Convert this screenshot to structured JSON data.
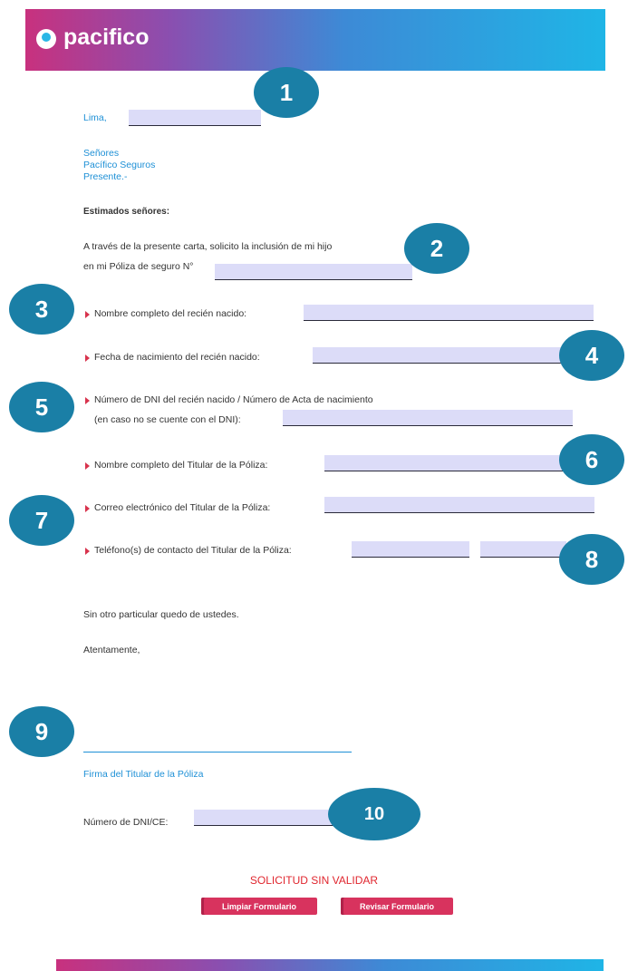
{
  "header": {
    "brand": "pacifico"
  },
  "letter": {
    "city_label": "Lima,",
    "recipient": [
      "Señores",
      "Pacífico Seguros",
      "Presente.-"
    ],
    "greeting": "Estimados señores:",
    "intro_line1": "A través de la presente carta, solicito la inclusión de mi hijo",
    "intro_line2": "en mi Póliza de seguro N°"
  },
  "fields": {
    "newborn_name_label": "Nombre completo del recién nacido:",
    "birth_date_label": "Fecha de nacimiento del recién nacido:",
    "dni_label_line1": "Número de DNI del recién nacido / Número de Acta de nacimiento",
    "dni_label_line2": "(en caso no se cuente con el DNI):",
    "holder_name_label": "Nombre completo del Titular de la Póliza:",
    "holder_email_label": "Correo electrónico del Titular de la Póliza:",
    "holder_phone_label": "Teléfono(s) de contacto del Titular de la Póliza:"
  },
  "closing": {
    "line1": "Sin otro particular quedo de ustedes.",
    "line2": "Atentamente,",
    "signature_label": "Firma del Titular de la Póliza",
    "dni_ce_label": "Número de DNI/CE:"
  },
  "status_text": "SOLICITUD SIN VALIDAR",
  "buttons": {
    "clear": "Limpiar Formulario",
    "review": "Revisar Formulario"
  },
  "badges": [
    "1",
    "2",
    "3",
    "4",
    "5",
    "6",
    "7",
    "8",
    "9",
    "10"
  ],
  "colors": {
    "accent_blue": "#1e90d6",
    "badge": "#1a7fa6",
    "button": "#d8335e",
    "status": "#e0262e"
  }
}
